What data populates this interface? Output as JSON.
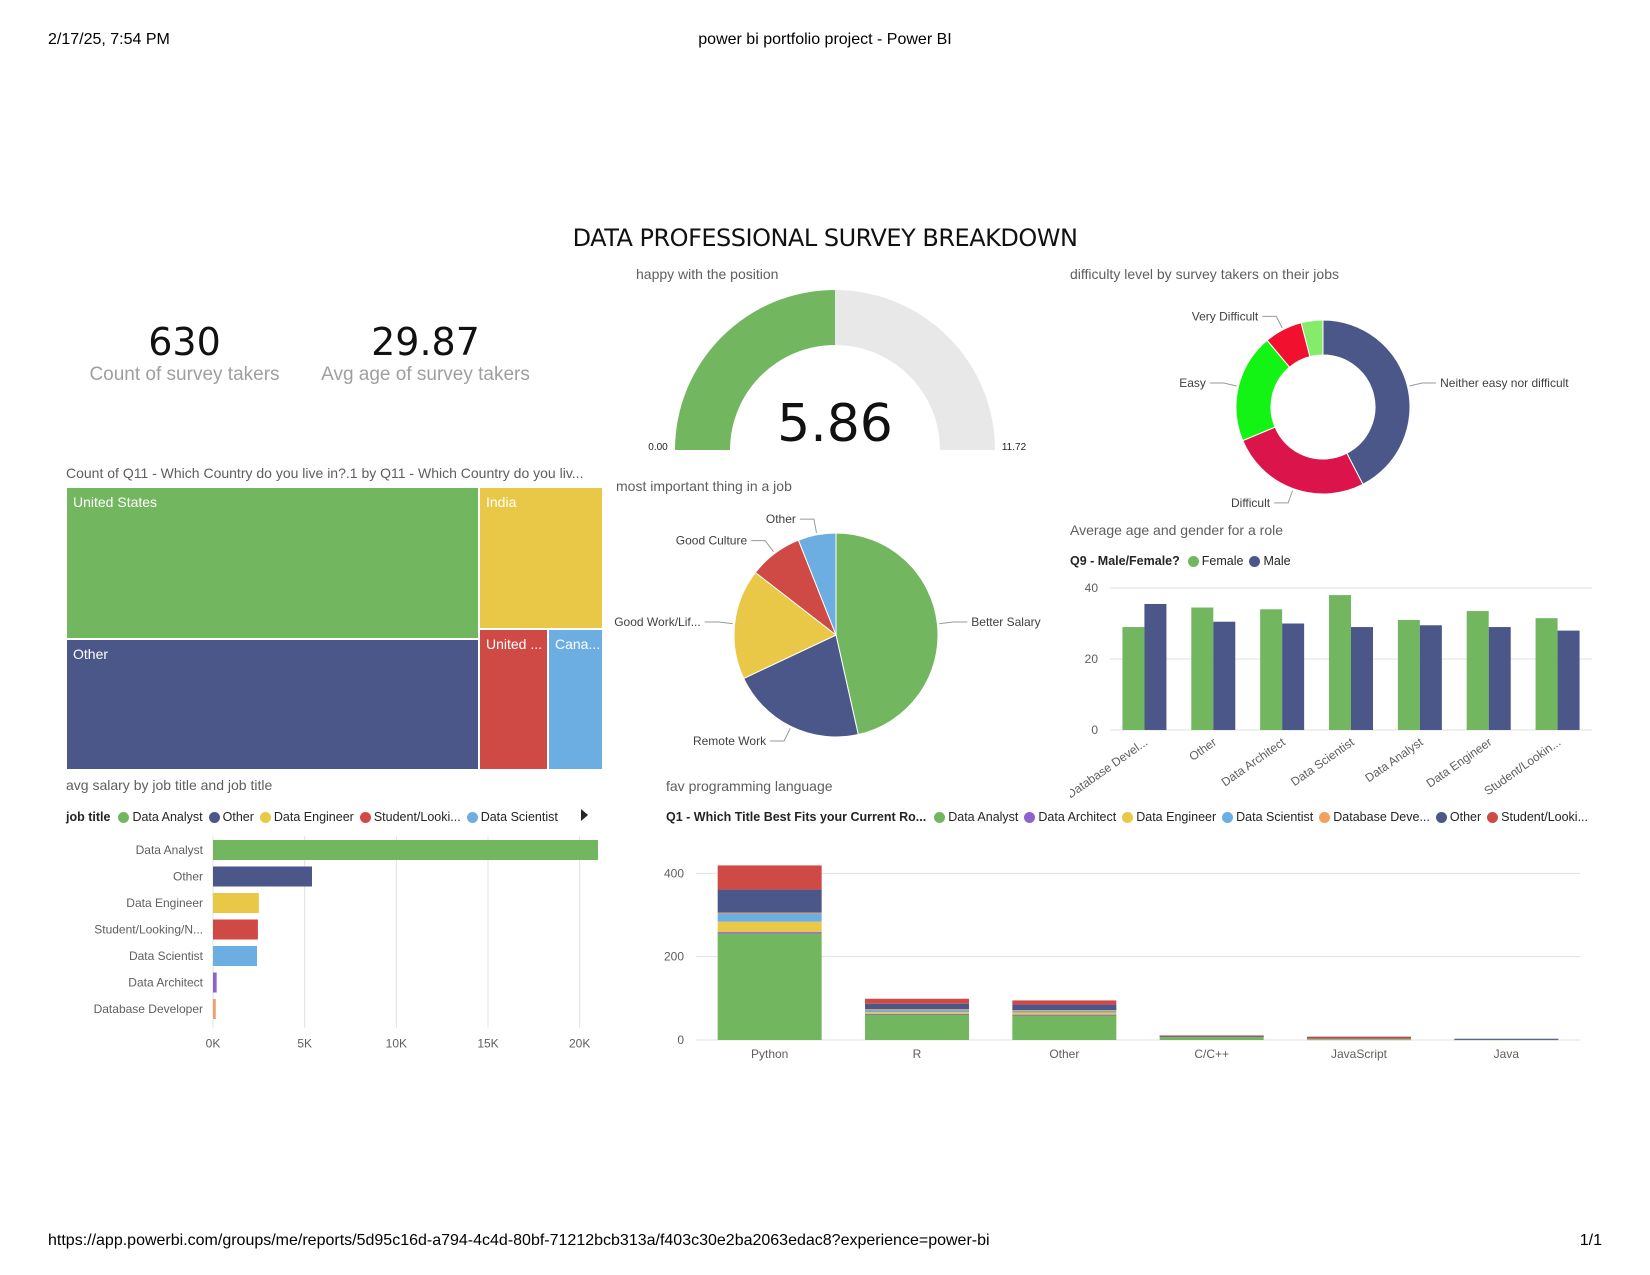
{
  "print_header": {
    "datetime": "2/17/25, 7:54 PM",
    "page_title": "power bi portfolio project - Power BI"
  },
  "print_footer": {
    "url": "https://app.powerbi.com/groups/me/reports/5d95c16d-a794-4c4d-80bf-71212bcb313a/f403c30e2ba2063edac8?experience=power-bi",
    "page": "1/1"
  },
  "dashboard_title": "DATA PROFESSIONAL SURVEY BREAKDOWN",
  "kpis": [
    {
      "value": "630",
      "label": "Count of survey takers"
    },
    {
      "value": "29.87",
      "label": "Avg age of survey takers"
    }
  ],
  "colors": {
    "green": "#72b75f",
    "navy": "#4a5788",
    "yellow": "#e9c747",
    "red": "#d04a45",
    "lightblue": "#6daee2",
    "purple": "#8e64cc",
    "orange": "#f0a060",
    "lime": "#14f414",
    "crimson": "#dc144c",
    "brightred": "#f1112f",
    "lightgreen": "#85ec6a",
    "gauge_bg": "#e8e8e8"
  },
  "chart_data": [
    {
      "id": "gauge",
      "type": "gauge",
      "title": "happy with the position",
      "value": 5.86,
      "value_label": "5.86",
      "min": 0,
      "max": 11.72,
      "min_label": "0.00",
      "max_label": "11.72"
    },
    {
      "id": "difficulty",
      "type": "donut",
      "title": "difficulty level by survey takers on their jobs",
      "slices": [
        {
          "label": "Neither easy nor difficult",
          "value": 42,
          "color": "#4a5788"
        },
        {
          "label": "Difficult",
          "value": 26,
          "color": "#dc144c"
        },
        {
          "label": "Easy",
          "value": 20,
          "color": "#14f414"
        },
        {
          "label": "Very Difficult",
          "value": 7,
          "color": "#f1112f"
        },
        {
          "label": "",
          "value": 4,
          "color": "#85ec6a"
        }
      ]
    },
    {
      "id": "country",
      "type": "treemap",
      "title": "Count of Q11 - Which Country do you live in?.1 by Q11 - Which Country do you liv...",
      "items": [
        {
          "label": "United States",
          "color": "#72b75f"
        },
        {
          "label": "Other",
          "color": "#4a5788"
        },
        {
          "label": "India",
          "color": "#e9c747"
        },
        {
          "label": "United ...",
          "color": "#d04a45"
        },
        {
          "label": "Cana...",
          "color": "#6daee2"
        }
      ]
    },
    {
      "id": "important",
      "type": "pie",
      "title": "most important thing in a job",
      "slices": [
        {
          "label": "Better Salary",
          "value": 46.5,
          "color": "#72b75f"
        },
        {
          "label": "Remote Work",
          "value": 21.5,
          "color": "#4a5788"
        },
        {
          "label": "Good Work/Lif...",
          "value": 17.5,
          "color": "#e9c747"
        },
        {
          "label": "Good Culture",
          "value": 8.5,
          "color": "#d04a45"
        },
        {
          "label": "Other",
          "value": 6,
          "color": "#6daee2"
        }
      ]
    },
    {
      "id": "age_gender",
      "type": "bar",
      "title": "Average age and gender for a role",
      "legend_title": "Q9 - Male/Female?",
      "categories": [
        "Database Devel...",
        "Other",
        "Data Architect",
        "Data Scientist",
        "Data Analyst",
        "Data Engineer",
        "Student/Lookin..."
      ],
      "series": [
        {
          "name": "Female",
          "color": "#72b75f",
          "values": [
            29,
            34.5,
            34,
            38,
            31,
            33.5,
            31.5
          ]
        },
        {
          "name": "Male",
          "color": "#4a5788",
          "values": [
            35.5,
            30.5,
            30,
            29,
            29.5,
            29,
            28
          ]
        }
      ],
      "ylim": [
        0,
        40
      ],
      "yticks": [
        "0",
        "20",
        "40"
      ]
    },
    {
      "id": "salary",
      "type": "bar",
      "orientation": "horizontal",
      "title": "avg salary by job title and job title",
      "legend_title": "job title",
      "legend": [
        {
          "name": "Data Analyst",
          "color": "#72b75f"
        },
        {
          "name": "Other",
          "color": "#4a5788"
        },
        {
          "name": "Data Engineer",
          "color": "#e9c747"
        },
        {
          "name": "Student/Looki...",
          "color": "#d04a45"
        },
        {
          "name": "Data Scientist",
          "color": "#6daee2"
        }
      ],
      "categories": [
        "Data Analyst",
        "Other",
        "Data Engineer",
        "Student/Looking/N...",
        "Data Scientist",
        "Data Architect",
        "Database Developer"
      ],
      "values": [
        21000,
        5400,
        2500,
        2450,
        2400,
        200,
        150
      ],
      "colors": [
        "#72b75f",
        "#4a5788",
        "#e9c747",
        "#d04a45",
        "#6daee2",
        "#8e64cc",
        "#f0a060"
      ],
      "xlim": [
        0,
        21000
      ],
      "xticks": [
        "0K",
        "5K",
        "10K",
        "15K",
        "20K"
      ]
    },
    {
      "id": "languages",
      "type": "bar",
      "stacked": true,
      "title": "fav programming language",
      "legend_title": "Q1 - Which Title Best Fits your Current Ro...",
      "categories": [
        "Python",
        "R",
        "Other",
        "C/C++",
        "JavaScript",
        "Java"
      ],
      "series": [
        {
          "name": "Data Analyst",
          "color": "#72b75f",
          "values": [
            255,
            62,
            60,
            8,
            2,
            2
          ]
        },
        {
          "name": "Data Architect",
          "color": "#8e64cc",
          "values": [
            4,
            1,
            1,
            0,
            0,
            0
          ]
        },
        {
          "name": "Data Engineer",
          "color": "#e9c747",
          "values": [
            25,
            4,
            5,
            0,
            0,
            0
          ]
        },
        {
          "name": "Data Scientist",
          "color": "#6daee2",
          "values": [
            20,
            6,
            5,
            1,
            0,
            0
          ]
        },
        {
          "name": "Database Deve...",
          "color": "#f0a060",
          "values": [
            2,
            1,
            1,
            0,
            2,
            0
          ]
        },
        {
          "name": "Other",
          "color": "#4a5788",
          "values": [
            55,
            13,
            13,
            1,
            2,
            1
          ]
        },
        {
          "name": "Student/Looki...",
          "color": "#d04a45",
          "values": [
            58,
            12,
            10,
            1,
            2,
            0
          ]
        }
      ],
      "ylim": [
        0,
        420
      ],
      "yticks": [
        "0",
        "200",
        "400"
      ]
    }
  ]
}
